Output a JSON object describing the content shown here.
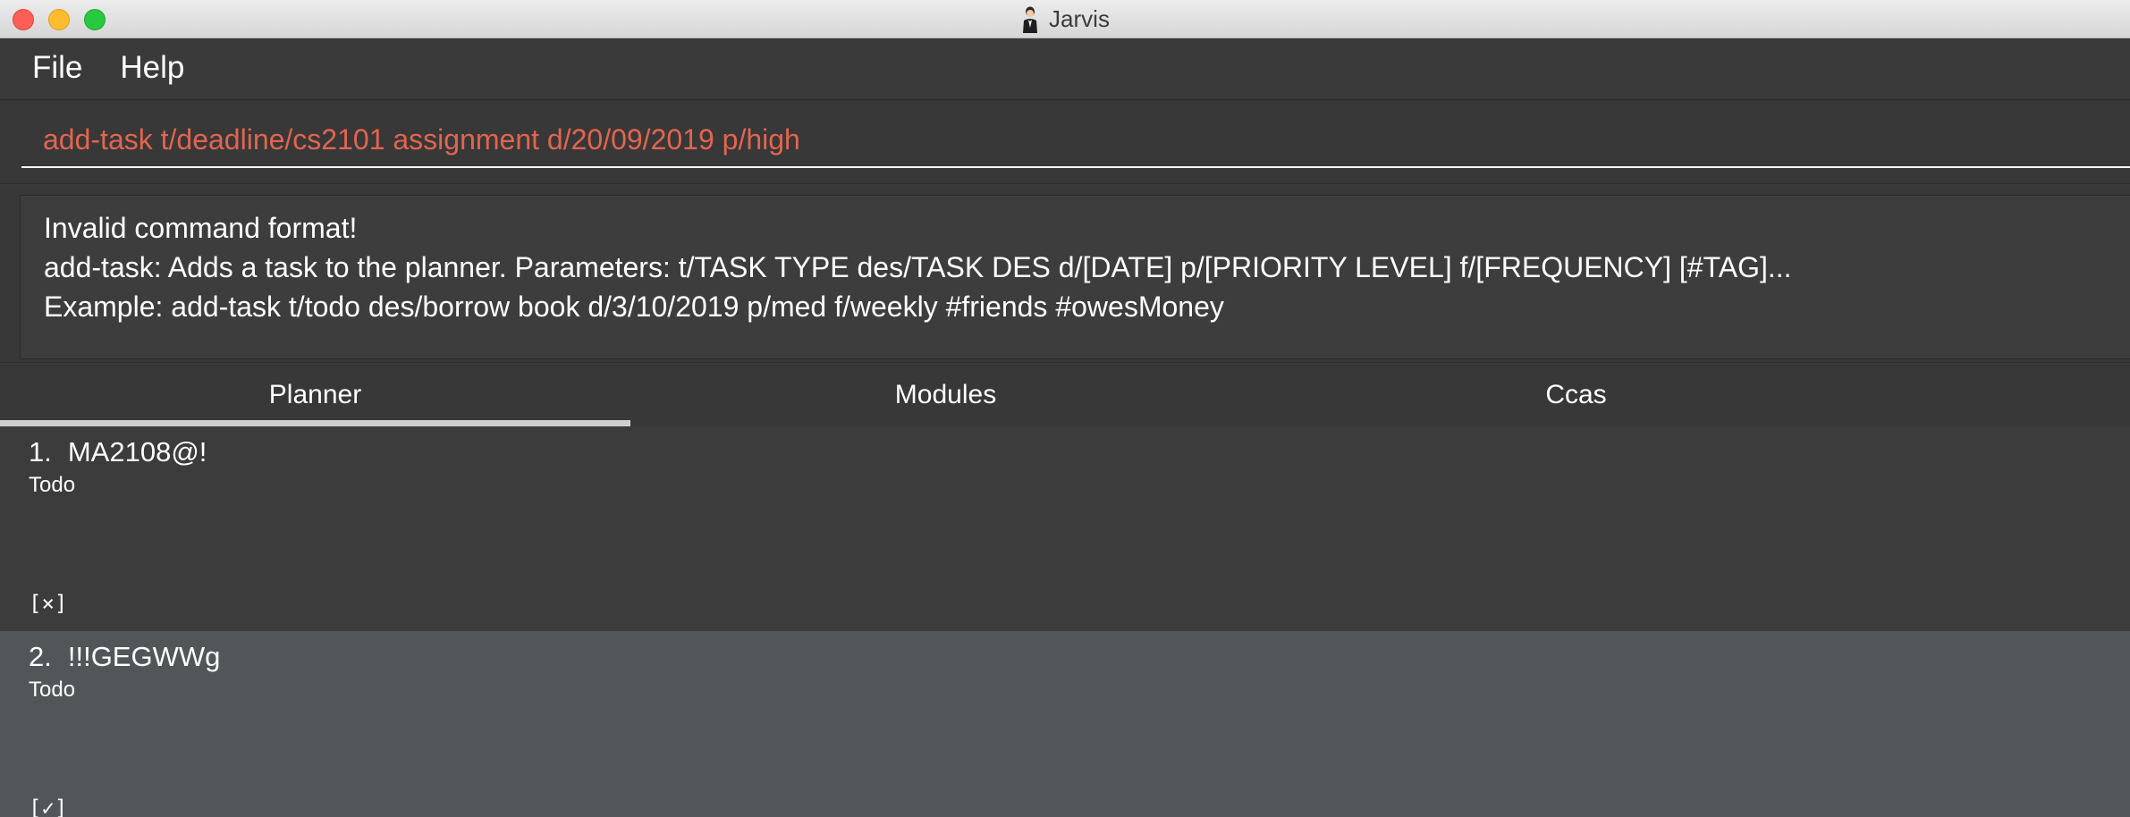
{
  "window": {
    "title": "Jarvis",
    "title_icon": "butler-icon"
  },
  "menu": {
    "file_label": "File",
    "help_label": "Help"
  },
  "command": {
    "value": "add-task t/deadline/cs2101 assignment d/20/09/2019 p/high",
    "text_color": "#e2654f"
  },
  "result": {
    "lines": [
      "Invalid command format!",
      "add-task: Adds a task to the planner. Parameters: t/TASK TYPE des/TASK DES d/[DATE] p/[PRIORITY LEVEL] f/[FREQUENCY] [#TAG]...",
      "Example: add-task t/todo des/borrow book d/3/10/2019 p/med f/weekly #friends #owesMoney"
    ]
  },
  "tabs": [
    {
      "label": "Planner",
      "active": true
    },
    {
      "label": "Modules",
      "active": false
    },
    {
      "label": "Ccas",
      "active": false
    }
  ],
  "tasks": [
    {
      "index": "1.",
      "name": "MA2108@!",
      "type": "Todo",
      "status": "[×]"
    },
    {
      "index": "2.",
      "name": "!!!GEGWWg",
      "type": "Todo",
      "status": "[✓]"
    }
  ]
}
